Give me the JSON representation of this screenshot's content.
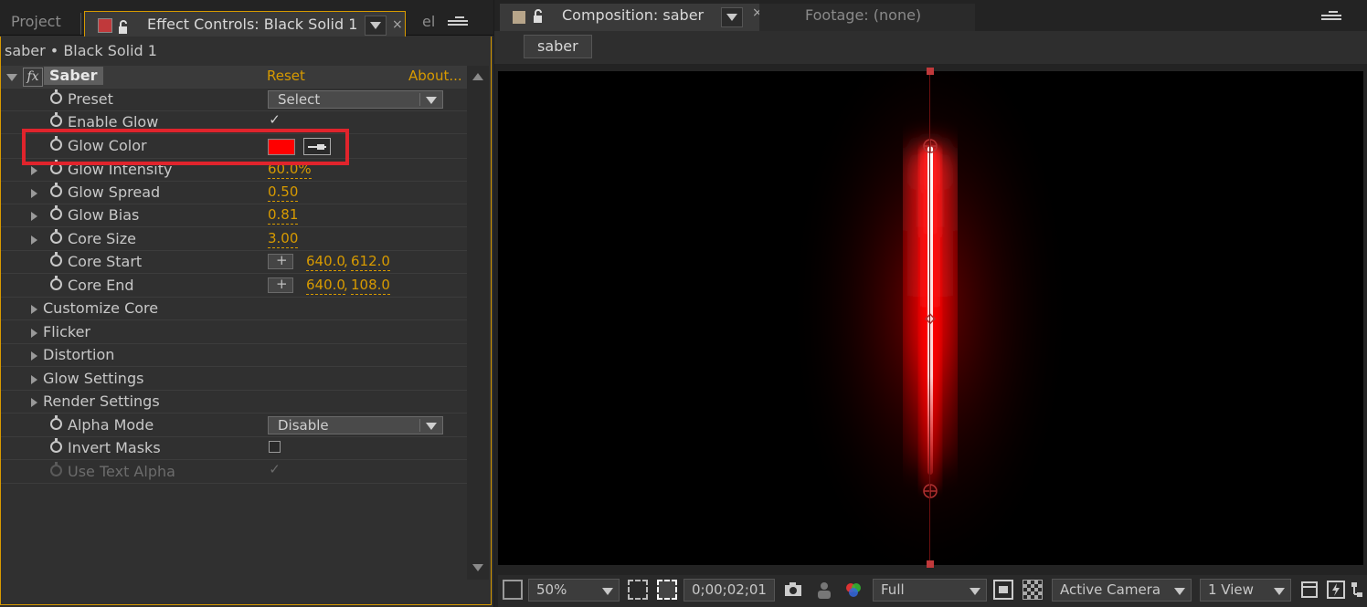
{
  "left_tabs": {
    "project": "Project",
    "effect_controls": "Effect Controls: Black Solid 1",
    "third": "el"
  },
  "layer_title": "saber • Black Solid 1",
  "effect": {
    "name": "Saber",
    "reset": "Reset",
    "about": "About..."
  },
  "rows": {
    "preset": {
      "label": "Preset",
      "value": "Select"
    },
    "enable_glow": {
      "label": "Enable Glow",
      "checked": "✓"
    },
    "glow_color": {
      "label": "Glow Color",
      "color": "#ff0000"
    },
    "glow_intensity": {
      "label": "Glow Intensity",
      "value": "60.0%"
    },
    "glow_spread": {
      "label": "Glow Spread",
      "value": "0.50"
    },
    "glow_bias": {
      "label": "Glow Bias",
      "value": "0.81"
    },
    "core_size": {
      "label": "Core Size",
      "value": "3.00"
    },
    "core_start": {
      "label": "Core Start",
      "x": "640.0",
      "y": "612.0"
    },
    "core_end": {
      "label": "Core End",
      "x": "640.0",
      "y": "108.0"
    },
    "customize_core": {
      "label": "Customize Core"
    },
    "flicker": {
      "label": "Flicker"
    },
    "distortion": {
      "label": "Distortion"
    },
    "glow_settings": {
      "label": "Glow Settings"
    },
    "render_settings": {
      "label": "Render Settings"
    },
    "alpha_mode": {
      "label": "Alpha Mode",
      "value": "Disable"
    },
    "invert_masks": {
      "label": "Invert Masks"
    },
    "use_text_alpha": {
      "label": "Use Text Alpha",
      "checked": "✓"
    }
  },
  "right_tabs": {
    "composition": "Composition: saber",
    "footage": "Footage: (none)"
  },
  "comp_name": "saber",
  "bottom": {
    "zoom": "50%",
    "timecode": "0;00;02;01",
    "resolution": "Full",
    "camera": "Active Camera",
    "views": "1 View"
  },
  "colors": {
    "accent": "#d79a00",
    "highlight": "#e0242c",
    "glow": "#ff0000"
  }
}
